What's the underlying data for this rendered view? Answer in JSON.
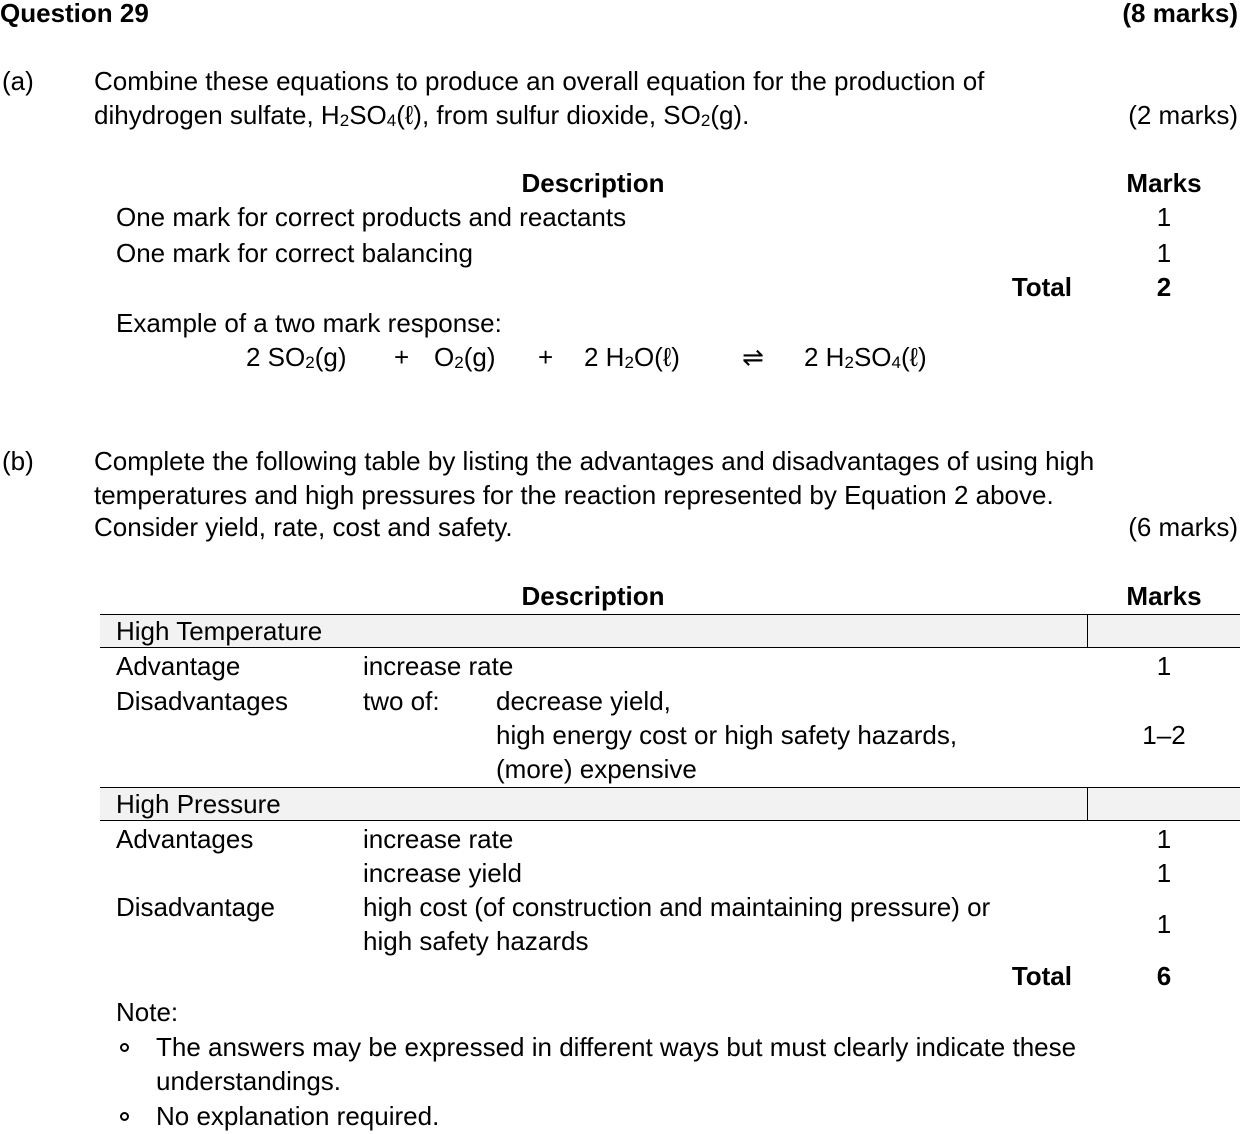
{
  "question": {
    "title": "Question 29",
    "marks": "(8 marks)"
  },
  "part_a": {
    "label": "(a)",
    "line1": "Combine these equations to produce an overall equation for the production of",
    "line2_pre": "dihydrogen sulfate, H",
    "line2_sub1": "2",
    "line2_mid1": "SO",
    "line2_sub2": "4",
    "line2_mid2": "(ℓ), from sulfur dioxide, SO",
    "line2_sub3": "2",
    "line2_post": "(g).",
    "marks": "(2 marks)",
    "table": {
      "header_description": "Description",
      "header_marks": "Marks",
      "rows": [
        {
          "description": "One mark for correct products and reactants",
          "marks": "1"
        },
        {
          "description": "One mark for correct balancing",
          "marks": "1"
        }
      ],
      "total_label": "Total",
      "total_value": "2"
    },
    "example_label": "Example of a two mark response:",
    "equation": {
      "t1_pre": "2 SO",
      "t1_sub": "2",
      "t1_post": "(g)",
      "plus1": "+",
      "t2_pre": "O",
      "t2_sub": "2",
      "t2_post": "(g)",
      "plus2": "+",
      "t3_pre": "2 H",
      "t3_sub": "2",
      "t3_post": "O(ℓ)",
      "arrow": "⇌",
      "t4_pre": "2 H",
      "t4_sub1": "2",
      "t4_mid": "SO",
      "t4_sub2": "4",
      "t4_post": "(ℓ)"
    }
  },
  "part_b": {
    "label": "(b)",
    "line1": "Complete the following table by listing the advantages and disadvantages of using high",
    "line2": "temperatures and high pressures for the reaction represented by Equation 2 above.",
    "line3": "Consider yield, rate, cost and safety.",
    "marks": "(6 marks)",
    "table": {
      "header_description": "Description",
      "header_marks": "Marks",
      "high_temp": {
        "heading": "High Temperature",
        "advantage_label": "Advantage",
        "advantage_text": "increase rate",
        "advantage_marks": "1",
        "disadvantages_label": "Disadvantages",
        "two_of": "two of:",
        "dis_line1": "decrease yield,",
        "dis_line2": "high energy cost or high safety hazards,",
        "dis_line3": "(more) expensive",
        "dis_marks": "1–2"
      },
      "high_pressure": {
        "heading": "High Pressure",
        "advantages_label": "Advantages",
        "adv1": "increase rate",
        "adv1_marks": "1",
        "adv2": "increase yield",
        "adv2_marks": "1",
        "disadvantage_label": "Disadvantage",
        "dis_line1": "high cost (of construction and maintaining pressure) or",
        "dis_line2": "high safety hazards",
        "dis_marks": "1"
      },
      "total_label": "Total",
      "total_value": "6"
    },
    "note_label": "Note:",
    "notes": [
      {
        "line1": "The answers may be expressed in different ways but must clearly indicate these",
        "line2": "understandings."
      },
      {
        "line1": "No explanation required."
      }
    ]
  }
}
